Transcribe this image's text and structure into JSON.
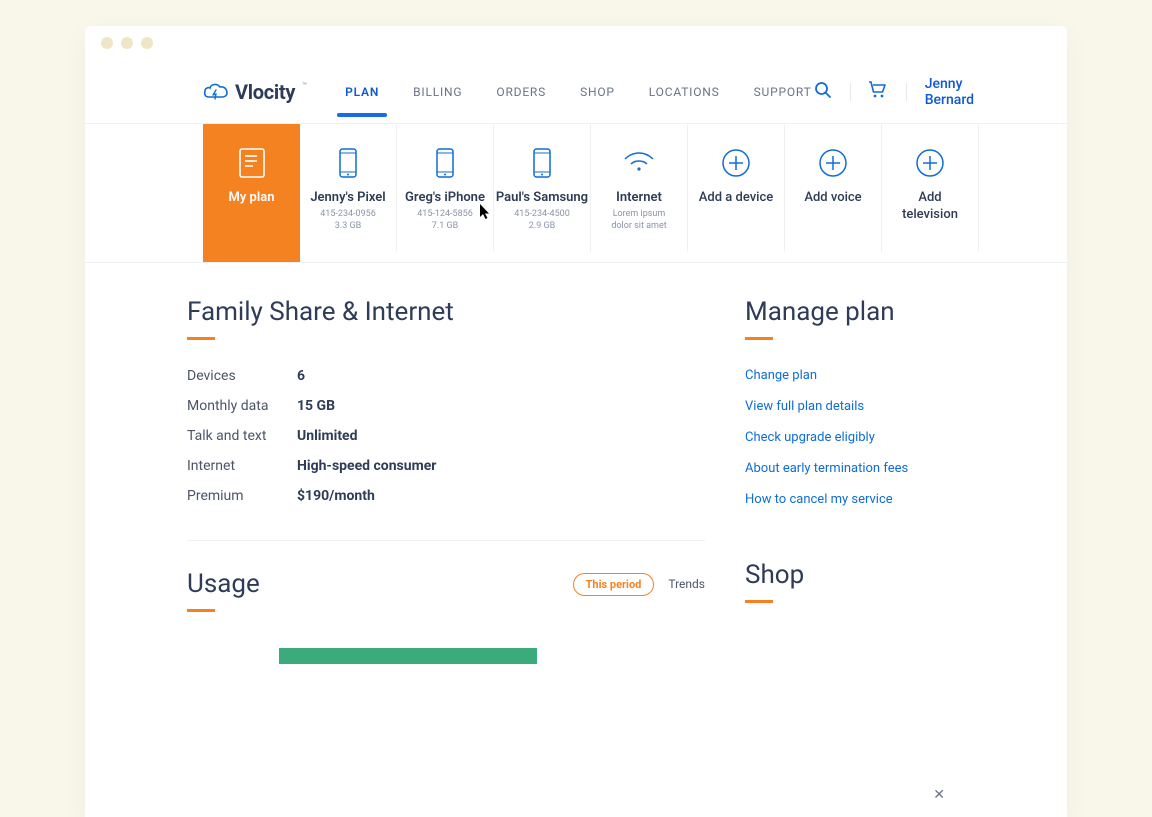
{
  "brand": {
    "name": "Vlocity"
  },
  "nav": {
    "items": [
      {
        "label": "PLAN",
        "active": true
      },
      {
        "label": "BILLING"
      },
      {
        "label": "ORDERS"
      },
      {
        "label": "SHOP"
      },
      {
        "label": "LOCATIONS"
      },
      {
        "label": "SUPPORT"
      }
    ],
    "user": "Jenny Bernard"
  },
  "tiles": [
    {
      "kind": "active",
      "label": "My plan"
    },
    {
      "kind": "device",
      "icon": "phone",
      "label": "Jenny's Pixel",
      "sub1": "415-234-0956",
      "sub2": "3.3 GB"
    },
    {
      "kind": "device",
      "icon": "phone",
      "label": "Greg's iPhone",
      "sub1": "415-124-5856",
      "sub2": "7.1 GB"
    },
    {
      "kind": "device",
      "icon": "phone",
      "label": "Paul's Samsung",
      "sub1": "415-234-4500",
      "sub2": "2.9 GB"
    },
    {
      "kind": "device",
      "icon": "wifi",
      "label": "Internet",
      "sub1": "Lorem ipsum",
      "sub2": "dolor sit amet"
    },
    {
      "kind": "add",
      "label": "Add a device"
    },
    {
      "kind": "add",
      "label": "Add voice"
    },
    {
      "kind": "add",
      "label": "Add television"
    }
  ],
  "plan": {
    "title": "Family Share & Internet",
    "rows": [
      {
        "k": "Devices",
        "v": "6"
      },
      {
        "k": "Monthly data",
        "v": "15 GB"
      },
      {
        "k": "Talk and text",
        "v": "Unlimited"
      },
      {
        "k": "Internet",
        "v": "High-speed consumer"
      },
      {
        "k": "Premium",
        "v": "$190/month"
      }
    ]
  },
  "manage": {
    "title": "Manage plan",
    "links": [
      "Change plan",
      "View full plan details",
      "Check upgrade eligibly",
      "About early termination fees",
      "How to cancel my service"
    ]
  },
  "usage": {
    "title": "Usage",
    "tab_active": "This period",
    "tab_other": "Trends"
  },
  "shop": {
    "title": "Shop"
  }
}
